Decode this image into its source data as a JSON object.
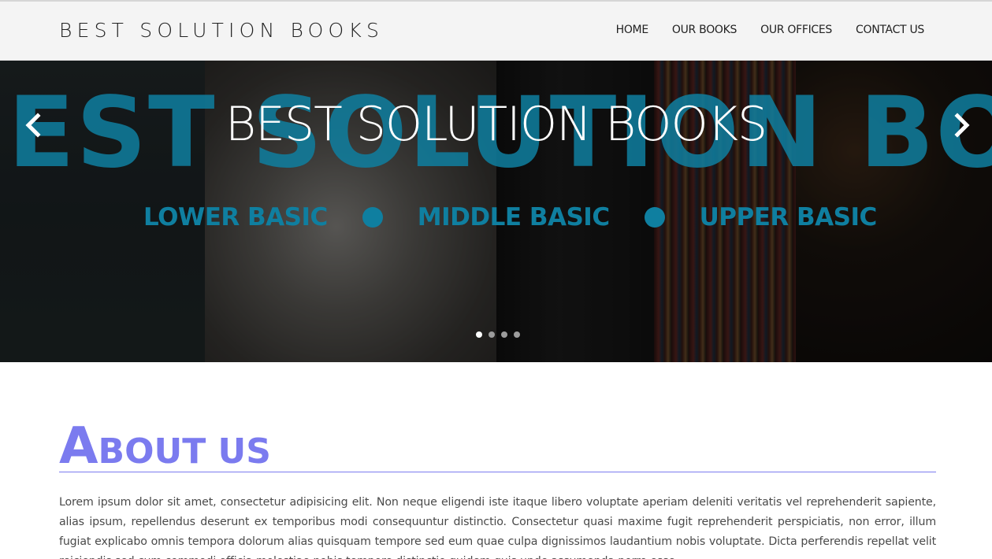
{
  "header": {
    "brand": "BEST SOLUTION BOOKS",
    "nav": [
      "HOME",
      "OUR BOOKS",
      "OUR OFFICES",
      "CONTACT US"
    ]
  },
  "carousel": {
    "background_text": "EST SOLUTION BOOK",
    "levels": [
      "LOWER BASIC",
      "MIDDLE BASIC",
      "UPPER BASIC"
    ],
    "caption": "BEST SOLUTION BOOKS",
    "slide_count": 4,
    "active_slide": 1,
    "accent_color": "#0f7fa0"
  },
  "about": {
    "heading_first_letter": "A",
    "heading_rest": "BOUT US",
    "heading_color": "#7b7bef",
    "paragraph": "Lorem ipsum dolor sit amet, consectetur adipisicing elit. Non neque eligendi iste itaque libero voluptate aperiam deleniti veritatis vel reprehenderit sapiente, alias ipsum, repellendus deserunt ex temporibus modi consequuntur distinctio. Consectetur quasi maxime fugit reprehenderit perspiciatis, non error, illum fugiat explicabo omnis tempora dolorum alias quisquam tempore sed eum quae culpa dignissimos laudantium nobis voluptate. Dicta perferendis repellat velit reiciendis sed cum commodi officia molestiae nobis tempore distinctio quidem quis unde assumenda porro esse."
  }
}
